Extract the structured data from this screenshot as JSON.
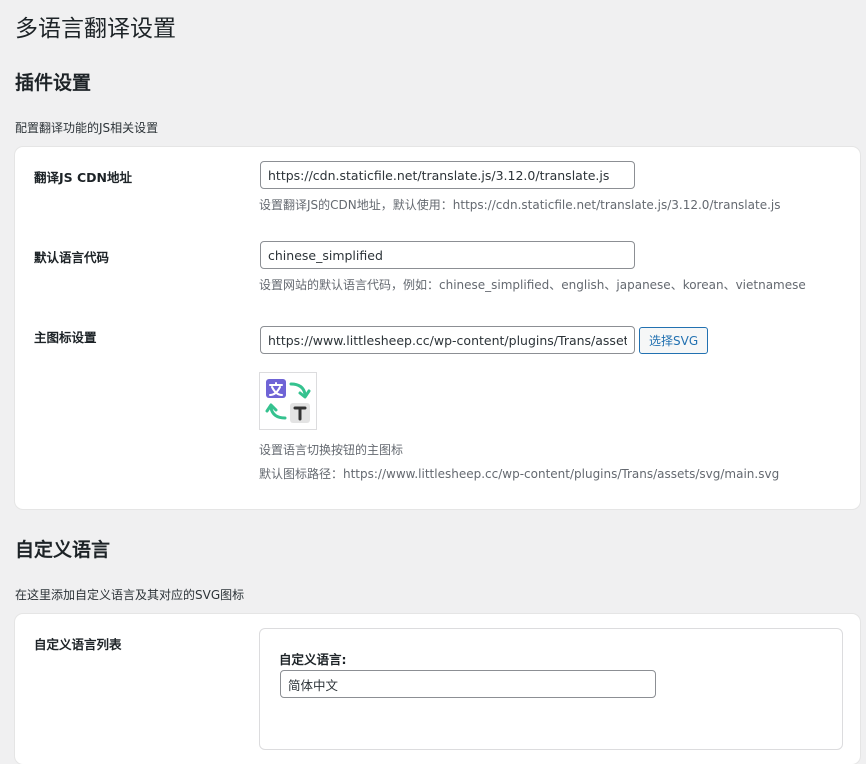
{
  "page_title": "多语言翻译设置",
  "plugin_section": {
    "title": "插件设置",
    "description": "配置翻译功能的JS相关设置",
    "rows": {
      "cdn": {
        "label": "翻译JS CDN地址",
        "value": "https://cdn.staticfile.net/translate.js/3.12.0/translate.js",
        "help": "设置翻译JS的CDN地址，默认使用：https://cdn.staticfile.net/translate.js/3.12.0/translate.js"
      },
      "default_lang": {
        "label": "默认语言代码",
        "value": "chinese_simplified",
        "help": "设置网站的默认语言代码，例如：chinese_simplified、english、japanese、korean、vietnamese"
      },
      "main_icon": {
        "label": "主图标设置",
        "value": "https://www.littlesheep.cc/wp-content/plugins/Trans/assets/svg/main.svg",
        "button_label": "选择SVG",
        "preview_icon": "translate-icon",
        "help": "设置语言切换按钮的主图标",
        "default_path": "默认图标路径：https://www.littlesheep.cc/wp-content/plugins/Trans/assets/svg/main.svg"
      }
    }
  },
  "custom_section": {
    "title": "自定义语言",
    "description": "在这里添加自定义语言及其对应的SVG图标",
    "list_label": "自定义语言列表",
    "item_label": "自定义语言:",
    "item_value": "简体中文"
  },
  "colors": {
    "accent": "#2271b1",
    "icon_purple": "#6f64d6",
    "icon_green": "#35c28f",
    "icon_gray": "#e3e3e3"
  }
}
